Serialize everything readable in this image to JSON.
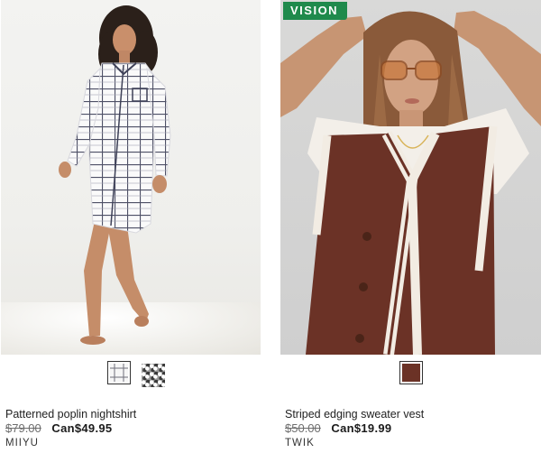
{
  "products": [
    {
      "name": "Patterned poplin nightshirt",
      "original_price": "$79.00",
      "sale_price": "Can$49.95",
      "brand": "MIIYU",
      "swatches": [
        {
          "color": "checked white/navy",
          "selected": true
        },
        {
          "color": "grey floral",
          "selected": false
        }
      ]
    },
    {
      "badge": "VISION",
      "name": "Striped edging sweater vest",
      "original_price": "$50.00",
      "sale_price": "Can$19.99",
      "brand": "TWIK",
      "swatches": [
        {
          "color": "brown",
          "selected": true
        }
      ]
    }
  ],
  "colors": {
    "badge_bg": "#1f8a4c",
    "vest_brown": "#6b3226",
    "strike_price": "#6d6d6d"
  }
}
